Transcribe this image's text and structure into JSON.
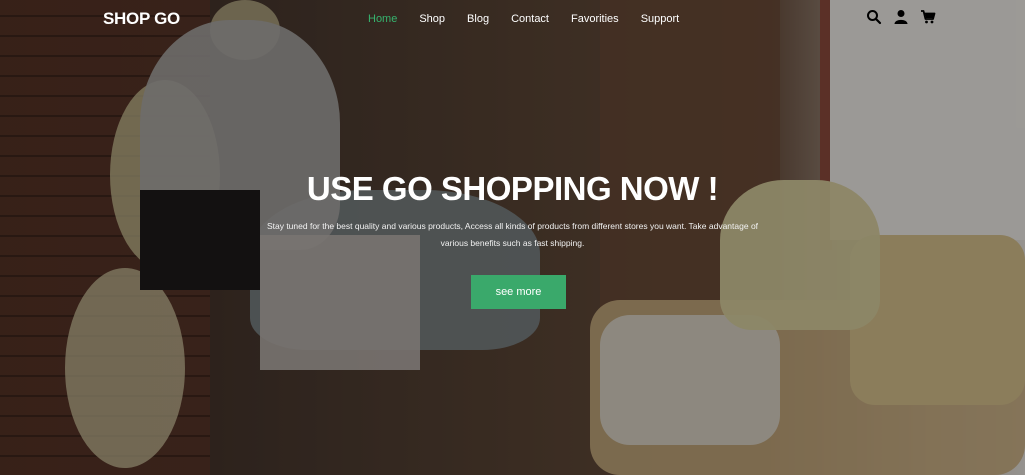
{
  "brand": {
    "logo": "SHOP GO"
  },
  "nav": {
    "items": [
      {
        "label": "Home",
        "active": true
      },
      {
        "label": "Shop",
        "active": false
      },
      {
        "label": "Blog",
        "active": false
      },
      {
        "label": "Contact",
        "active": false
      },
      {
        "label": "Favorities",
        "active": false
      },
      {
        "label": "Support",
        "active": false
      }
    ],
    "active_color": "#36b36e",
    "icons": [
      "search-icon",
      "user-icon",
      "cart-icon"
    ]
  },
  "hero": {
    "headline": "USE GO SHOPPING NOW !",
    "subtitle": "Stay tuned for the best quality and various products, Access all kinds of products from different stores you want. Take advantage of various benefits such as fast shipping.",
    "cta_label": "see more",
    "cta_color": "#3aa96b"
  }
}
